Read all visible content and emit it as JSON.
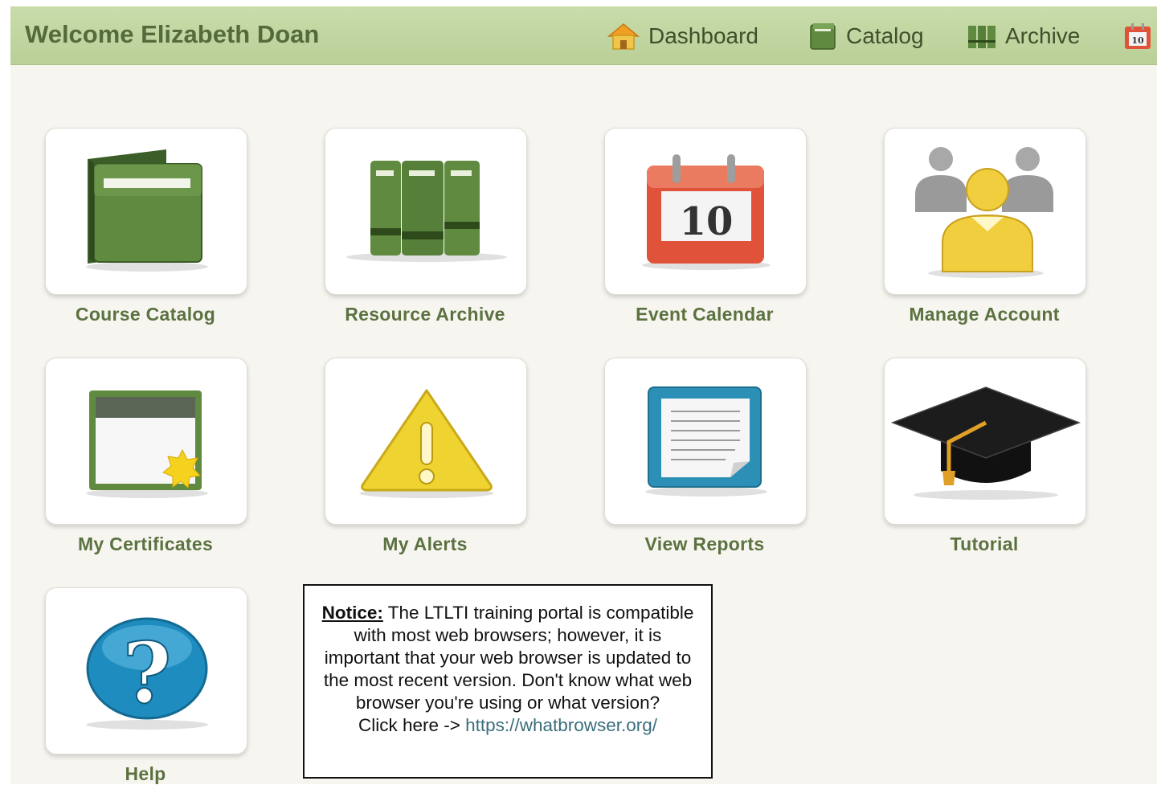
{
  "header": {
    "welcome": "Welcome Elizabeth Doan",
    "nav": [
      {
        "label": "Dashboard",
        "icon": "home-icon"
      },
      {
        "label": "Catalog",
        "icon": "catalog-icon"
      },
      {
        "label": "Archive",
        "icon": "archive-icon"
      },
      {
        "label": "",
        "icon": "calendar-icon"
      }
    ]
  },
  "tiles": [
    {
      "label": "Course Catalog",
      "icon": "book-icon"
    },
    {
      "label": "Resource Archive",
      "icon": "binders-icon"
    },
    {
      "label": "Event Calendar",
      "icon": "calendar-icon",
      "calendar_day": "10"
    },
    {
      "label": "Manage Account",
      "icon": "users-icon"
    },
    {
      "label": "My Certificates",
      "icon": "certificate-icon"
    },
    {
      "label": "My Alerts",
      "icon": "warning-icon"
    },
    {
      "label": "View Reports",
      "icon": "report-icon"
    },
    {
      "label": "Tutorial",
      "icon": "graduation-cap-icon"
    },
    {
      "label": "Help",
      "icon": "help-icon"
    }
  ],
  "notice": {
    "heading": "Notice:",
    "body": "The LTLTI training portal is compatible with most web browsers; however, it is important that your web browser is updated to the most recent version. Don't know what web browser you're using or what version?",
    "link_prefix": "Click here ->",
    "link": "https://whatbrowser.org/"
  },
  "colors": {
    "header_bg": "#c3d7a4",
    "header_text": "#536a3a",
    "label_text": "#5b7240",
    "page_bg": "#f7f5f0"
  }
}
